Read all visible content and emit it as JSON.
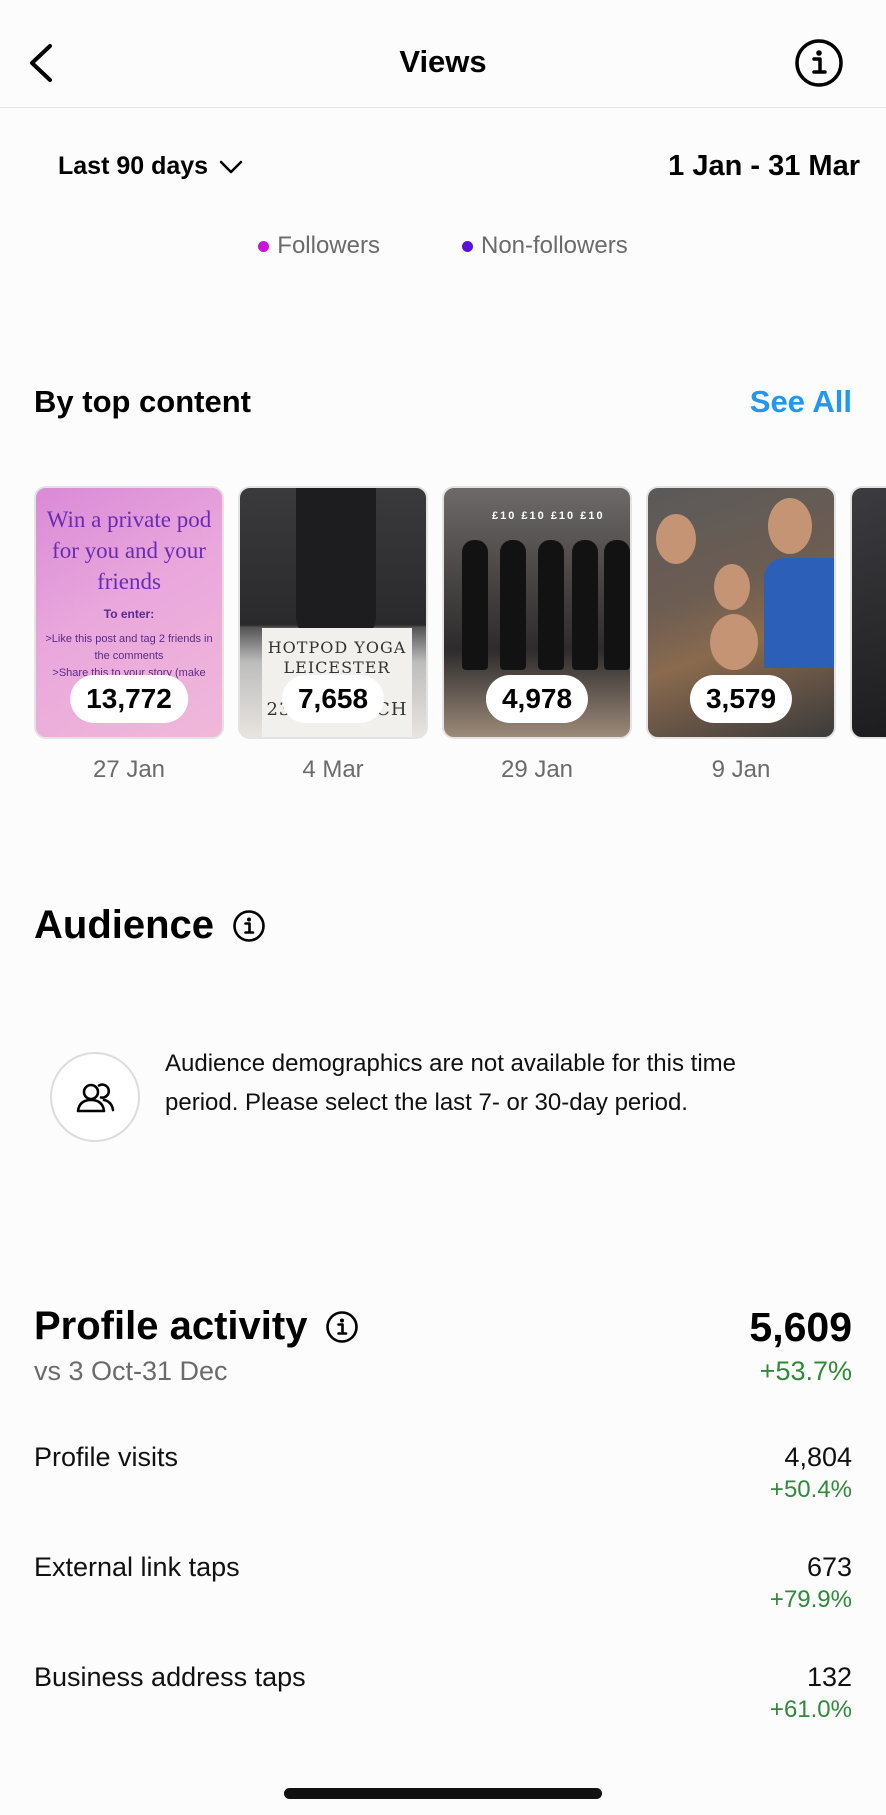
{
  "header": {
    "title": "Views"
  },
  "filters": {
    "range_label": "Last 90 days",
    "date_range": "1 Jan - 31 Mar"
  },
  "legend": {
    "followers": {
      "label": "Followers",
      "color": "#c913d6"
    },
    "non_followers": {
      "label": "Non-followers",
      "color": "#5b12d8"
    }
  },
  "top_content": {
    "title": "By top content",
    "see_all": "See All",
    "items": [
      {
        "count": "13,772",
        "date": "27 Jan",
        "caption": "Win a private pod for you and your friends",
        "small_lines": [
          "To enter:",
          ">Like this post and tag 2 friends in the comments",
          ">Share this to your story (make"
        ]
      },
      {
        "count": "7,658",
        "date": "4 Mar",
        "card_lines": [
          "HOTPOD YOGA",
          "LEICESTER",
          "23RD MARCH"
        ]
      },
      {
        "count": "4,978",
        "date": "29 Jan",
        "signs": "£10 £10 £10 £10"
      },
      {
        "count": "3,579",
        "date": "9 Jan"
      }
    ]
  },
  "audience": {
    "title": "Audience",
    "message": "Audience demographics are not available for this time period. Please select the last 7- or 30-day period."
  },
  "profile_activity": {
    "title": "Profile activity",
    "comparison": "vs 3 Oct-31 Dec",
    "total": "5,609",
    "total_change": "+53.7%",
    "metrics": [
      {
        "label": "Profile visits",
        "value": "4,804",
        "change": "+50.4%"
      },
      {
        "label": "External link taps",
        "value": "673",
        "change": "+79.9%"
      },
      {
        "label": "Business address taps",
        "value": "132",
        "change": "+61.0%"
      }
    ]
  },
  "icons": {
    "back": "chevron-left-icon",
    "info": "info-icon",
    "dropdown": "chevron-down-icon",
    "audience": "people-icon"
  },
  "colors": {
    "link": "#2196f3",
    "positive": "#2f8a3a"
  }
}
